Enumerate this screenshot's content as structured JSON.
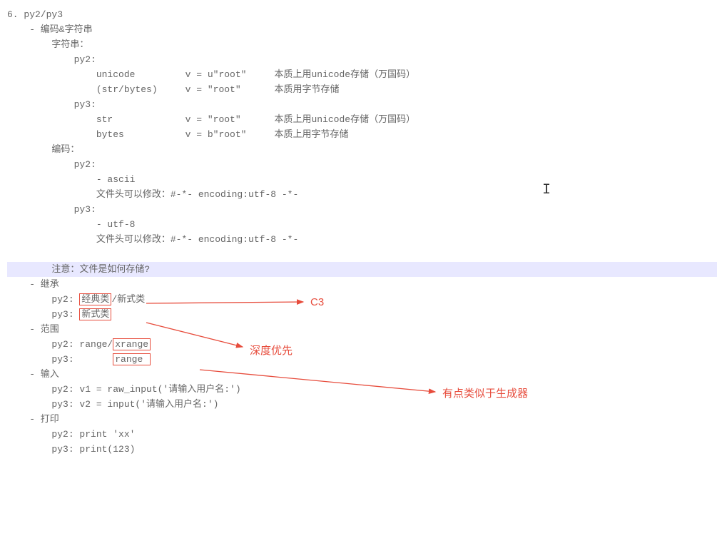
{
  "lines": {
    "l1": "6. py2/py3",
    "l2": "    - 编码&字符串",
    "l3": "        字符串：",
    "l4": "            py2:",
    "l5": "                unicode         v = u\"root\"     本质上用unicode存储（万国码）",
    "l6": "                (str/bytes)     v = \"root\"      本质用字节存储",
    "l7": "            py3:",
    "l8": "                str             v = \"root\"      本质上用unicode存储（万国码）",
    "l9": "                bytes           v = b\"root\"     本质上用字节存储",
    "l10": "        编码：",
    "l11": "            py2:",
    "l12": "                - ascii",
    "l13": "                文件头可以修改：#-*- encoding:utf-8 -*-",
    "l14": "            py3:",
    "l15": "                - utf-8",
    "l16": "                文件头可以修改：#-*- encoding:utf-8 -*-",
    "l17": " ",
    "l18": "        注意：文件是如何存储?",
    "l19": "    - 继承",
    "l20a": "        py2: ",
    "l20b": "经典类",
    "l20c": "/新式类",
    "l21a": "        py3: ",
    "l21b": "新式类",
    "l22": "    - 范围",
    "l23a": "        py2: range/",
    "l23b": "xrange",
    "l24a": "        py3:       ",
    "l24b": "range ",
    "l25": "    - 输入",
    "l26": "        py2: v1 = raw_input('请输入用户名:')",
    "l27": "        py3: v2 = input('请输入用户名:')",
    "l28": "    - 打印",
    "l29": "        py2: print 'xx'",
    "l30": "        py3: print(123)"
  },
  "annotations": {
    "c3": "C3",
    "depth": "深度优先",
    "generator": "有点类似于生成器"
  }
}
